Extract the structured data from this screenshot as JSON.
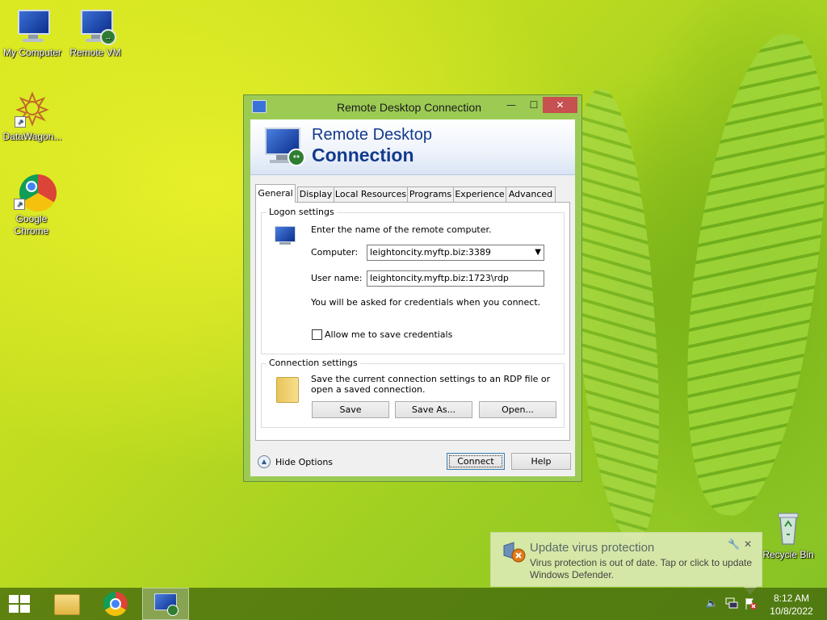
{
  "desktop": {
    "icons": [
      {
        "label": "My Computer",
        "icon": "computer-icon"
      },
      {
        "label": "Remote VM",
        "icon": "remote-desktop-icon"
      },
      {
        "label": "DataWagon...",
        "icon": "datawagon-shortcut-icon"
      },
      {
        "label": "Google Chrome",
        "icon": "chrome-icon"
      },
      {
        "label": "Recycle Bin",
        "icon": "recycle-bin-icon"
      }
    ]
  },
  "window": {
    "title": "Remote Desktop Connection",
    "banner_line1": "Remote Desktop",
    "banner_line2": "Connection",
    "minimize_label": "—",
    "maximize_label": "☐",
    "close_label": "✕"
  },
  "tabs": [
    {
      "label": "General",
      "active": true
    },
    {
      "label": "Display"
    },
    {
      "label": "Local Resources"
    },
    {
      "label": "Programs"
    },
    {
      "label": "Experience"
    },
    {
      "label": "Advanced"
    }
  ],
  "logon": {
    "group_label": "Logon settings",
    "instruction": "Enter the name of the remote computer.",
    "computer_label": "Computer:",
    "computer_value": "leightoncity.myftp.biz:3389",
    "username_label": "User name:",
    "username_value": "leightoncity.myftp.biz:1723\\rdp",
    "credentials_note": "You will be asked for credentials when you connect.",
    "save_credentials_label": "Allow me to save credentials",
    "save_credentials_checked": false
  },
  "connection": {
    "group_label": "Connection settings",
    "description": "Save the current connection settings to an RDP file or open a saved connection.",
    "save_label": "Save",
    "save_as_label": "Save As...",
    "open_label": "Open..."
  },
  "footer": {
    "hide_options_label": "Hide Options",
    "connect_label": "Connect",
    "help_label": "Help"
  },
  "notification": {
    "title": "Update virus protection",
    "message": "Virus protection is out of date. Tap or click to update Windows Defender."
  },
  "taskbar": {
    "time": "8:12 AM",
    "date": "10/8/2022"
  },
  "colors": {
    "close_button": "#c75050",
    "banner_text": "#123a8c",
    "window_frame": "#9ccb54"
  }
}
